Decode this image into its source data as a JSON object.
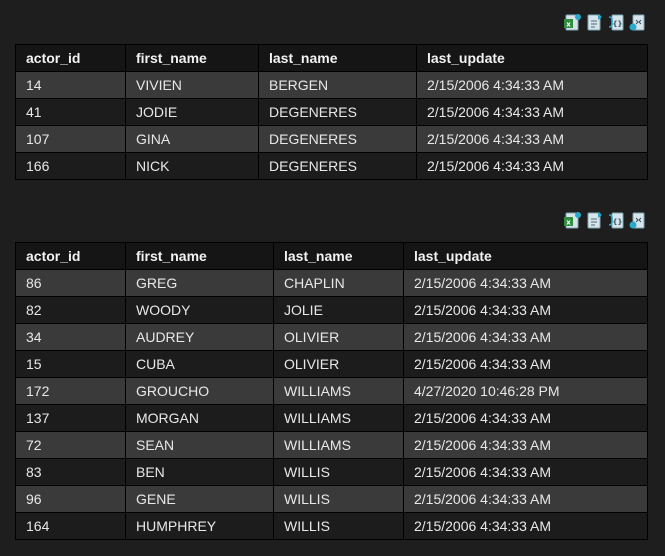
{
  "result1": {
    "columns": [
      "actor_id",
      "first_name",
      "last_name",
      "last_update"
    ],
    "rows": [
      [
        "14",
        "VIVIEN",
        "BERGEN",
        "2/15/2006 4:34:33 AM"
      ],
      [
        "41",
        "JODIE",
        "DEGENERES",
        "2/15/2006 4:34:33 AM"
      ],
      [
        "107",
        "GINA",
        "DEGENERES",
        "2/15/2006 4:34:33 AM"
      ],
      [
        "166",
        "NICK",
        "DEGENERES",
        "2/15/2006 4:34:33 AM"
      ]
    ]
  },
  "result2": {
    "columns": [
      "actor_id",
      "first_name",
      "last_name",
      "last_update"
    ],
    "rows": [
      [
        "86",
        "GREG",
        "CHAPLIN",
        "2/15/2006 4:34:33 AM"
      ],
      [
        "82",
        "WOODY",
        "JOLIE",
        "2/15/2006 4:34:33 AM"
      ],
      [
        "34",
        "AUDREY",
        "OLIVIER",
        "2/15/2006 4:34:33 AM"
      ],
      [
        "15",
        "CUBA",
        "OLIVIER",
        "2/15/2006 4:34:33 AM"
      ],
      [
        "172",
        "GROUCHO",
        "WILLIAMS",
        "4/27/2020 10:46:28 PM"
      ],
      [
        "137",
        "MORGAN",
        "WILLIAMS",
        "2/15/2006 4:34:33 AM"
      ],
      [
        "72",
        "SEAN",
        "WILLIAMS",
        "2/15/2006 4:34:33 AM"
      ],
      [
        "83",
        "BEN",
        "WILLIS",
        "2/15/2006 4:34:33 AM"
      ],
      [
        "96",
        "GENE",
        "WILLIS",
        "2/15/2006 4:34:33 AM"
      ],
      [
        "164",
        "HUMPHREY",
        "WILLIS",
        "2/15/2006 4:34:33 AM"
      ]
    ]
  },
  "toolbar": {
    "icons": [
      "export-excel-icon",
      "export-csv-icon",
      "export-json-icon",
      "export-xml-icon"
    ]
  },
  "colors": {
    "background": "#1e1e1e",
    "header_bg": "#151515",
    "row_odd": "#3a3a3a",
    "row_even": "#1c1c1c",
    "icon_accent": "#2aa8c9"
  }
}
